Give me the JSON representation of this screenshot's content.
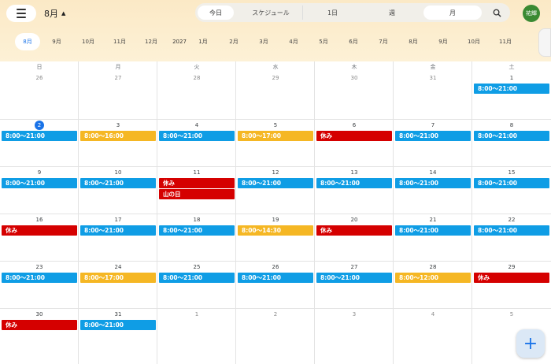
{
  "header": {
    "month_label": "8月",
    "avatar_text": "祐輝",
    "view_buttons": {
      "today": "今日",
      "schedule": "スケジュール",
      "day": "1日",
      "week": "週",
      "month": "月"
    }
  },
  "month_strip": [
    {
      "label": "8月",
      "selected": true
    },
    {
      "label": "9月"
    },
    {
      "label": "10月"
    },
    {
      "label": "11月"
    },
    {
      "label": "12月"
    },
    {
      "label": "2027",
      "year": true
    },
    {
      "label": "1月"
    },
    {
      "label": "2月"
    },
    {
      "label": "3月"
    },
    {
      "label": "4月"
    },
    {
      "label": "5月"
    },
    {
      "label": "6月"
    },
    {
      "label": "7月"
    },
    {
      "label": "8月"
    },
    {
      "label": "9月"
    },
    {
      "label": "10月"
    },
    {
      "label": "11月"
    }
  ],
  "weekdays": [
    "日",
    "月",
    "火",
    "水",
    "木",
    "金",
    "土"
  ],
  "colors": {
    "blue": "#0f9de5",
    "yellow": "#f5b724",
    "red": "#d50000",
    "today": "#1a73e8"
  },
  "weeks": [
    [
      {
        "day": "26",
        "other": true
      },
      {
        "day": "27",
        "other": true
      },
      {
        "day": "28",
        "other": true
      },
      {
        "day": "29",
        "other": true
      },
      {
        "day": "30",
        "other": true
      },
      {
        "day": "31",
        "other": true
      },
      {
        "day": "1",
        "events": [
          {
            "text": "8:00～21:00",
            "color": "blue"
          }
        ]
      }
    ],
    [
      {
        "day": "2",
        "today": true,
        "events": [
          {
            "text": "8:00～21:00",
            "color": "blue"
          }
        ]
      },
      {
        "day": "3",
        "events": [
          {
            "text": "8:00～16:00",
            "color": "yellow"
          }
        ]
      },
      {
        "day": "4",
        "events": [
          {
            "text": "8:00～21:00",
            "color": "blue"
          }
        ]
      },
      {
        "day": "5",
        "events": [
          {
            "text": "8:00～17:00",
            "color": "yellow"
          }
        ]
      },
      {
        "day": "6",
        "events": [
          {
            "text": "休み",
            "color": "red"
          }
        ]
      },
      {
        "day": "7",
        "events": [
          {
            "text": "8:00～21:00",
            "color": "blue"
          }
        ]
      },
      {
        "day": "8",
        "events": [
          {
            "text": "8:00～21:00",
            "color": "blue"
          }
        ]
      }
    ],
    [
      {
        "day": "9",
        "events": [
          {
            "text": "8:00～21:00",
            "color": "blue"
          }
        ]
      },
      {
        "day": "10",
        "events": [
          {
            "text": "8:00～21:00",
            "color": "blue"
          }
        ]
      },
      {
        "day": "11",
        "events": [
          {
            "text": "休み",
            "color": "red"
          },
          {
            "text": "山の日",
            "color": "red"
          }
        ]
      },
      {
        "day": "12",
        "events": [
          {
            "text": "8:00～21:00",
            "color": "blue"
          }
        ]
      },
      {
        "day": "13",
        "events": [
          {
            "text": "8:00～21:00",
            "color": "blue"
          }
        ]
      },
      {
        "day": "14",
        "events": [
          {
            "text": "8:00～21:00",
            "color": "blue"
          }
        ]
      },
      {
        "day": "15",
        "events": [
          {
            "text": "8:00～21:00",
            "color": "blue"
          }
        ]
      }
    ],
    [
      {
        "day": "16",
        "events": [
          {
            "text": "休み",
            "color": "red"
          }
        ]
      },
      {
        "day": "17",
        "events": [
          {
            "text": "8:00～21:00",
            "color": "blue"
          }
        ]
      },
      {
        "day": "18",
        "events": [
          {
            "text": "8:00～21:00",
            "color": "blue"
          }
        ]
      },
      {
        "day": "19",
        "events": [
          {
            "text": "8:00～14:30",
            "color": "yellow"
          }
        ]
      },
      {
        "day": "20",
        "events": [
          {
            "text": "休み",
            "color": "red"
          }
        ]
      },
      {
        "day": "21",
        "events": [
          {
            "text": "8:00～21:00",
            "color": "blue"
          }
        ]
      },
      {
        "day": "22",
        "events": [
          {
            "text": "8:00～21:00",
            "color": "blue"
          }
        ]
      }
    ],
    [
      {
        "day": "23",
        "events": [
          {
            "text": "8:00～21:00",
            "color": "blue"
          }
        ]
      },
      {
        "day": "24",
        "events": [
          {
            "text": "8:00～17:00",
            "color": "yellow"
          }
        ]
      },
      {
        "day": "25",
        "events": [
          {
            "text": "8:00～21:00",
            "color": "blue"
          }
        ]
      },
      {
        "day": "26",
        "events": [
          {
            "text": "8:00～21:00",
            "color": "blue"
          }
        ]
      },
      {
        "day": "27",
        "events": [
          {
            "text": "8:00～21:00",
            "color": "blue"
          }
        ]
      },
      {
        "day": "28",
        "events": [
          {
            "text": "8:00～12:00",
            "color": "yellow"
          }
        ]
      },
      {
        "day": "29",
        "events": [
          {
            "text": "休み",
            "color": "red"
          }
        ]
      }
    ],
    [
      {
        "day": "30",
        "events": [
          {
            "text": "休み",
            "color": "red"
          }
        ]
      },
      {
        "day": "31",
        "events": [
          {
            "text": "8:00～21:00",
            "color": "blue"
          }
        ]
      },
      {
        "day": "1",
        "other": true
      },
      {
        "day": "2",
        "other": true
      },
      {
        "day": "3",
        "other": true
      },
      {
        "day": "4",
        "other": true
      },
      {
        "day": "5",
        "other": true
      }
    ]
  ],
  "fab_label": "+"
}
